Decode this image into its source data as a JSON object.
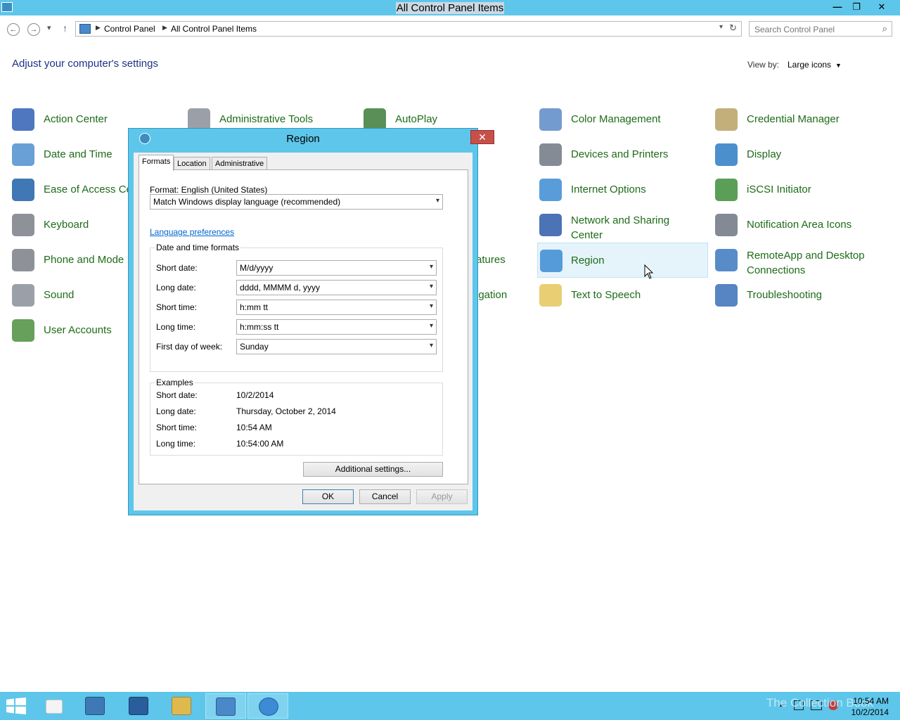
{
  "window": {
    "title": "All Control Panel Items",
    "min_glyph": "—",
    "max_glyph": "❐",
    "close_glyph": "✕"
  },
  "address": {
    "back_glyph": "←",
    "forward_glyph": "→",
    "recent_glyph": "▾",
    "up_glyph": "↑",
    "crumbs": [
      "Control Panel",
      "All Control Panel Items"
    ],
    "sep_glyph": "▶",
    "dropdown_glyph": "▾",
    "refresh_glyph": "↻",
    "search_placeholder": "Search Control Panel",
    "search_glyph": "⌕"
  },
  "main": {
    "heading": "Adjust your computer's settings",
    "view_by_label": "View by:",
    "view_by_value": "Large icons",
    "caret": "▼",
    "items": [
      {
        "label": "Action Center",
        "icon": "flag-icon",
        "color": "#2f5fb5"
      },
      {
        "label": "Administrative Tools",
        "icon": "gears-icon",
        "color": "#8a8f99"
      },
      {
        "label": "AutoPlay",
        "icon": "autoplay-icon",
        "color": "#3d7d3a"
      },
      {
        "label": "Color Management",
        "icon": "color-management-icon",
        "color": "#5b89c8"
      },
      {
        "label": "Credential Manager",
        "icon": "vault-icon",
        "color": "#b8a163"
      },
      {
        "label": "Date and Time",
        "icon": "calendar-clock-icon",
        "color": "#4f8fcf"
      },
      {
        "label": "Devices and Printers",
        "icon": "printer-icon",
        "color": "#6f7782"
      },
      {
        "label": "Display",
        "icon": "monitor-icon",
        "color": "#2d7bc4"
      },
      {
        "label": "Ease of Access Ce",
        "icon": "ease-of-access-icon",
        "color": "#1f5fa8"
      },
      {
        "label": "Internet Options",
        "icon": "globe-icon",
        "color": "#3c8bd4"
      },
      {
        "label": "iSCSI Initiator",
        "icon": "globe-network-icon",
        "color": "#3d8d3a"
      },
      {
        "label": "Keyboard",
        "icon": "keyboard-icon",
        "color": "#7a7f86"
      },
      {
        "label": "Network and Sharing\nCenter",
        "icon": "network-icon",
        "color": "#2b5aa8"
      },
      {
        "label": "Notification Area Icons",
        "icon": "notification-icon",
        "color": "#6d7683"
      },
      {
        "label": "Phone and Mode",
        "icon": "phone-icon",
        "color": "#7a7f86"
      },
      {
        "label": "atures",
        "icon": "",
        "color": ""
      },
      {
        "label": "Region",
        "icon": "region-globe-icon",
        "color": "#3c8bd4"
      },
      {
        "label": "RemoteApp and Desktop\nConnections",
        "icon": "remoteapp-icon",
        "color": "#3a78c0"
      },
      {
        "label": "Sound",
        "icon": "speaker-icon",
        "color": "#8a8f99"
      },
      {
        "label": "igation",
        "icon": "",
        "color": ""
      },
      {
        "label": "Text to Speech",
        "icon": "speech-bubble-icon",
        "color": "#e5c55a"
      },
      {
        "label": "Troubleshooting",
        "icon": "troubleshoot-icon",
        "color": "#3a6fb8"
      },
      {
        "label": "User Accounts",
        "icon": "users-icon",
        "color": "#4b8f3e"
      }
    ]
  },
  "dialog": {
    "title": "Region",
    "close_glyph": "✕",
    "tabs": [
      "Formats",
      "Location",
      "Administrative"
    ],
    "format_label": "Format: English (United States)",
    "format_value": "Match Windows display language (recommended)",
    "language_link": "Language preferences",
    "dt_group": "Date and time formats",
    "rows": [
      {
        "label": "Short date:",
        "value": "M/d/yyyy"
      },
      {
        "label": "Long date:",
        "value": "dddd, MMMM d, yyyy"
      },
      {
        "label": "Short time:",
        "value": "h:mm tt"
      },
      {
        "label": "Long time:",
        "value": "h:mm:ss tt"
      },
      {
        "label": "First day of week:",
        "value": "Sunday"
      }
    ],
    "examples_group": "Examples",
    "examples": [
      {
        "label": "Short date:",
        "value": "10/2/2014"
      },
      {
        "label": "Long date:",
        "value": "Thursday, October 2, 2014"
      },
      {
        "label": "Short time:",
        "value": "10:54 AM"
      },
      {
        "label": "Long time:",
        "value": "10:54:00 AM"
      }
    ],
    "additional_btn": "Additional settings...",
    "ok_btn": "OK",
    "cancel_btn": "Cancel",
    "apply_btn": "Apply",
    "arrow_glyph": "▾"
  },
  "taskbar": {
    "watermark": "The Collection Book",
    "time": "10:54 AM",
    "date": "10/2/2014",
    "tray_up": "▲"
  }
}
